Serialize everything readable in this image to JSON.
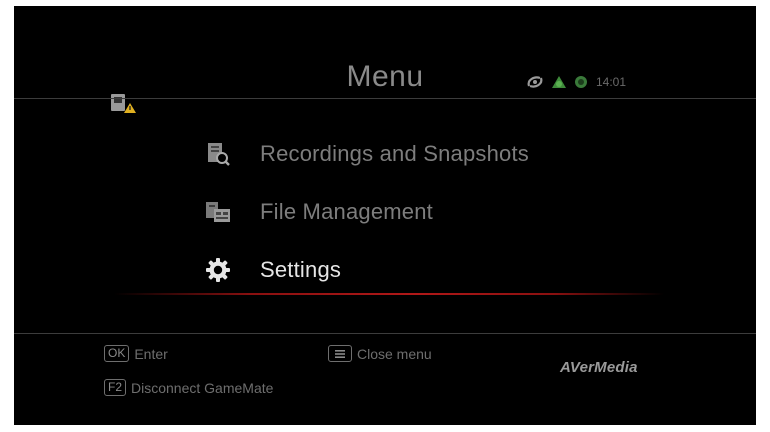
{
  "header": {
    "title": "Menu",
    "clock": "14:01",
    "icons": [
      "sd-card-warning-icon",
      "swirl-status-icon",
      "leaf-status-icon",
      "globe-status-icon"
    ]
  },
  "menu": {
    "items": [
      {
        "label": "Recordings and Snapshots",
        "icon": "recordings-search-icon",
        "active": false
      },
      {
        "label": "File Management",
        "icon": "file-management-icon",
        "active": false
      },
      {
        "label": "Settings",
        "icon": "gear-icon",
        "active": true
      }
    ]
  },
  "footer": {
    "hints": [
      {
        "key": "OK",
        "label": "Enter"
      },
      {
        "key": "menu-key-icon",
        "label": "Close menu"
      },
      {
        "key": "F2",
        "label": "Disconnect GameMate"
      }
    ],
    "brand": "AVerMedia"
  },
  "colors": {
    "background": "#000000",
    "selection": "#b01818",
    "text_active": "#e6e6e6",
    "text_inactive": "#7d7d7d"
  }
}
